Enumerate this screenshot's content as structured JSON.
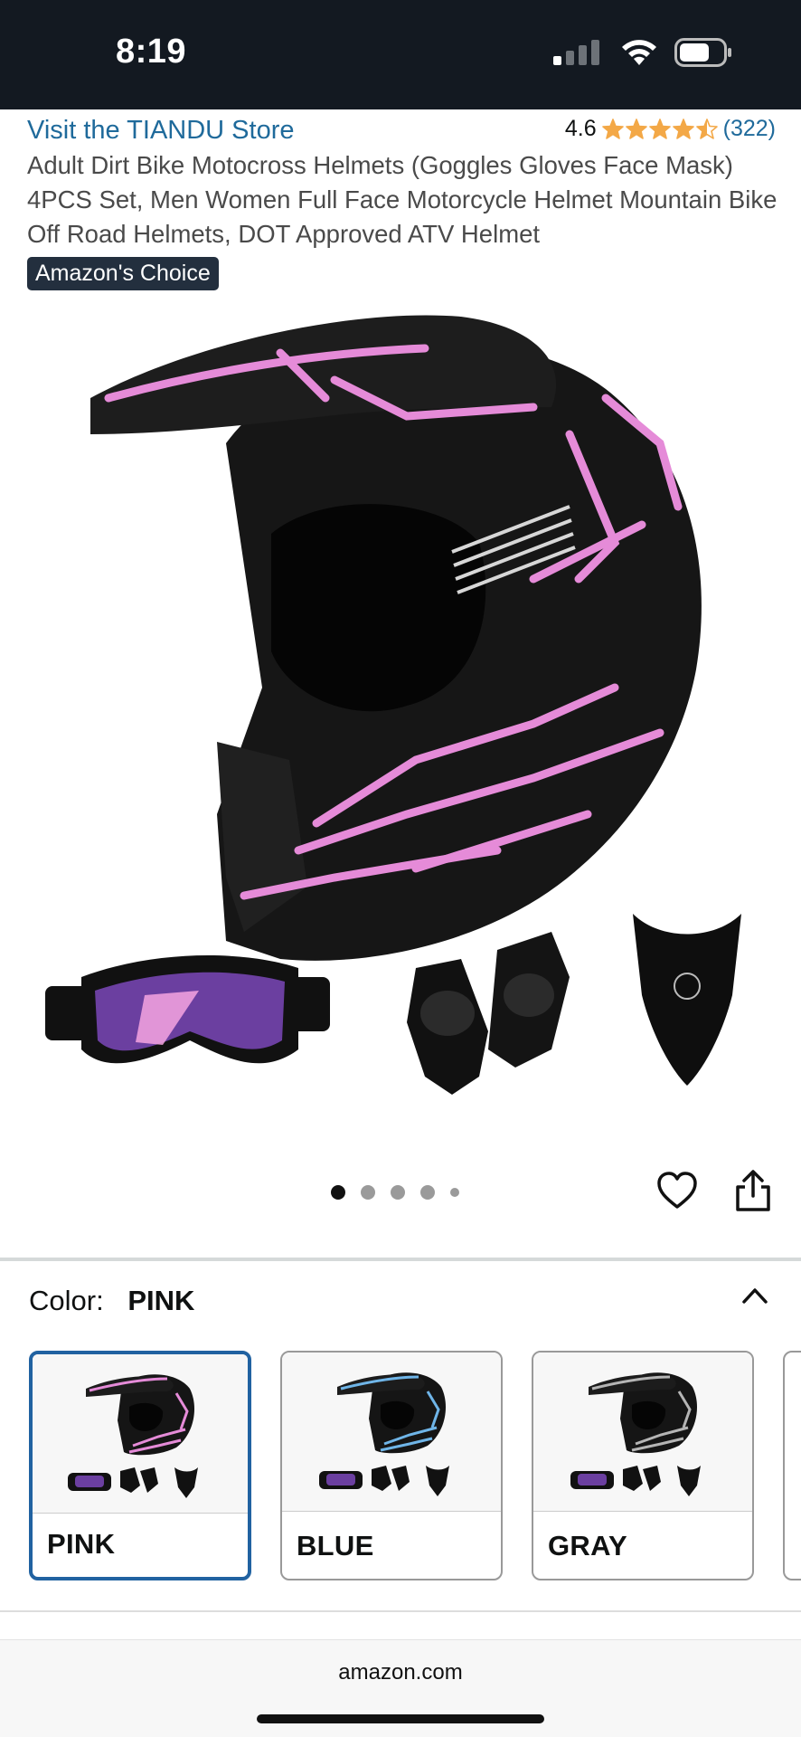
{
  "status_bar": {
    "time": "8:19"
  },
  "store": {
    "link_text": "Visit the TIANDU Store"
  },
  "rating": {
    "value": "4.6",
    "stars": 4.5,
    "count": "(322)",
    "star_color": "#f3a847"
  },
  "product": {
    "title": "Adult Dirt Bike Motocross Helmets (Goggles Gloves Face Mask) 4PCS Set, Men Women Full Face Motorcycle Helmet Mountain Bike Off Road Helmets, DOT Approved ATV Helmet",
    "badge": "Amazon's Choice",
    "accent_color": "#e58bd8"
  },
  "gallery": {
    "image_count": 5,
    "active_index": 0
  },
  "color_selector": {
    "label": "Color:",
    "selected_value": "PINK",
    "options": [
      {
        "label": "PINK",
        "accent": "#e58bd8",
        "selected": true
      },
      {
        "label": "BLUE",
        "accent": "#6fb5e8",
        "selected": false
      },
      {
        "label": "GRAY",
        "accent": "#b5b5b5",
        "selected": false
      }
    ]
  },
  "browser": {
    "url": "amazon.com"
  }
}
